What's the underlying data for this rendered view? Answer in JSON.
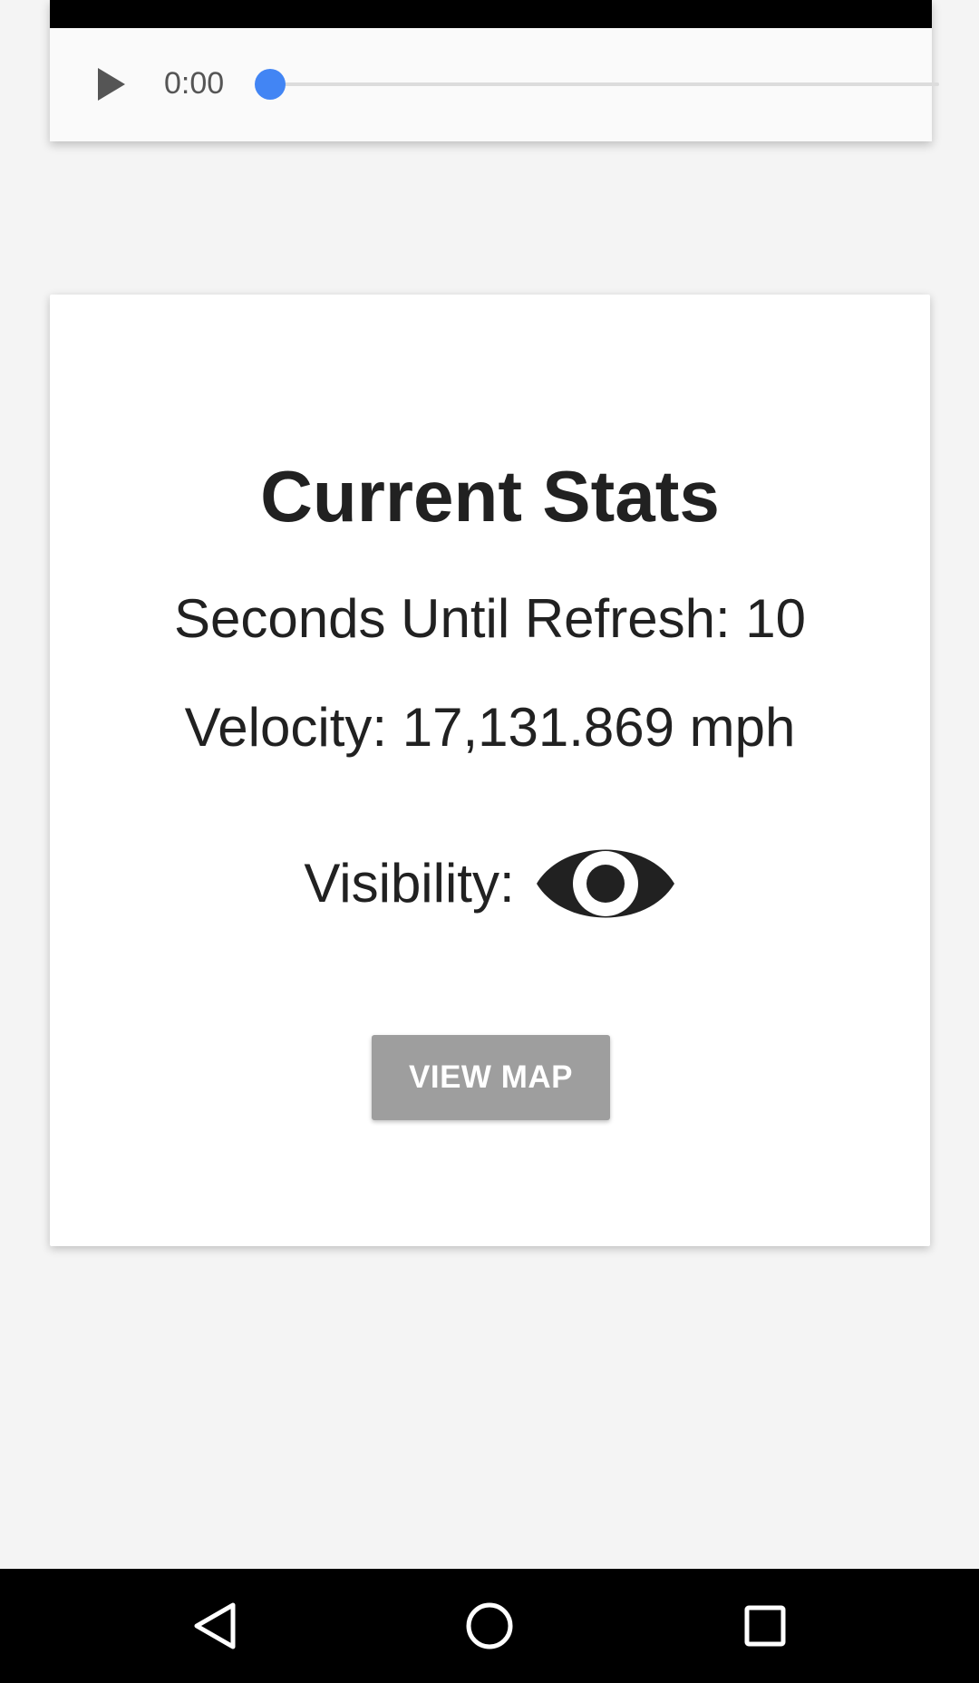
{
  "audio_player": {
    "time": "0:00",
    "progress_fraction": 0.0,
    "accent_color": "#4285f4",
    "play_icon": "play-icon"
  },
  "stats": {
    "title": "Current Stats",
    "refresh_label": "Seconds Until Refresh: 10",
    "velocity_label": "Velocity: 17,131.869 mph",
    "visibility_label": "Visibility:",
    "visibility_icon": "eye-icon",
    "view_map_label": "VIEW MAP"
  },
  "navigation_bar": {
    "back_icon": "back-triangle-icon",
    "home_icon": "home-circle-icon",
    "recents_icon": "recents-square-icon"
  }
}
